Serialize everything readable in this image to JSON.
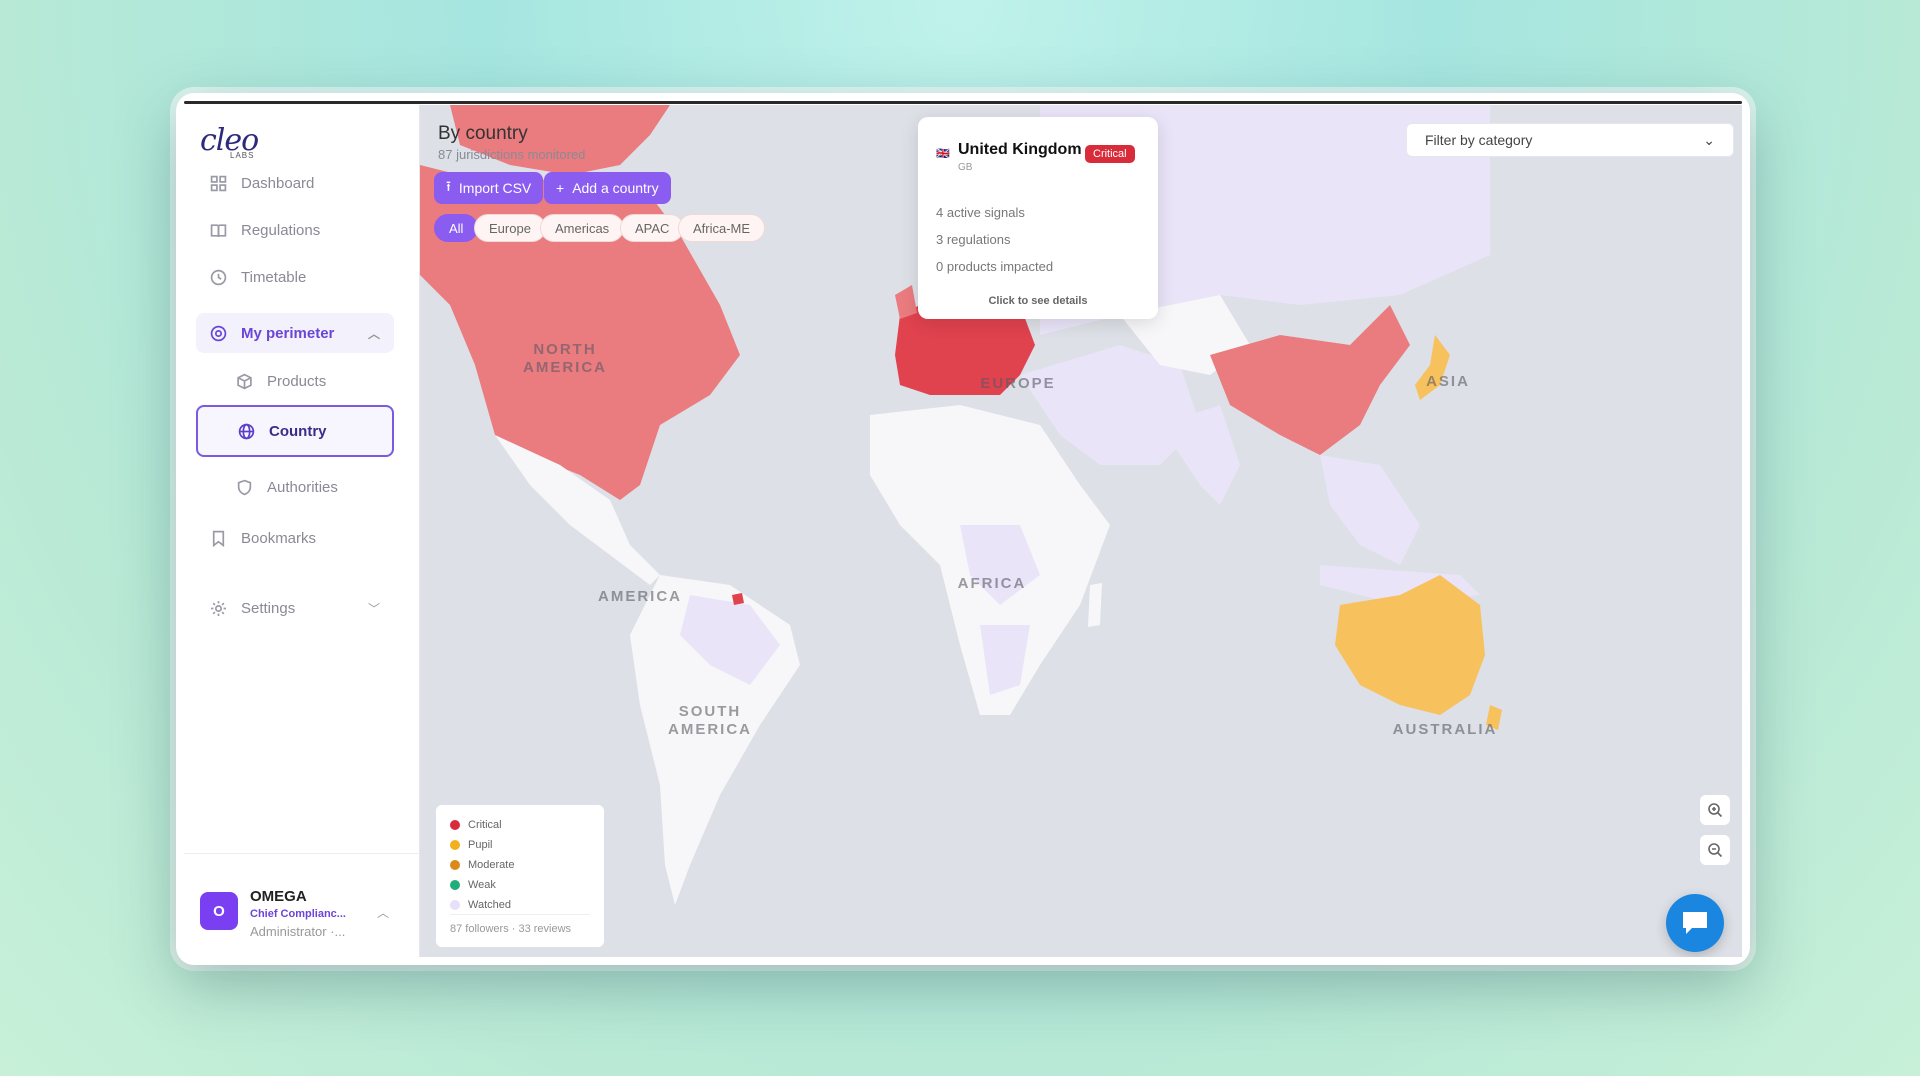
{
  "brand": {
    "logo": "cleo",
    "logo_sub": "LABS"
  },
  "nav": {
    "dashboard": "Dashboard",
    "regulations": "Regulations",
    "timetable": "Timetable",
    "my_perimeter": "My perimeter",
    "products": "Products",
    "country": "Country",
    "authorities": "Authorities",
    "bookmarks": "Bookmarks",
    "settings": "Settings"
  },
  "user": {
    "initial": "O",
    "name": "OMEGA",
    "role": "Chief Complianc...",
    "permission": "Administrator ·..."
  },
  "map": {
    "title": "By country",
    "subtitle": "87 jurisdictions monitored",
    "import_csv": "Import CSV",
    "add_country": "Add a country",
    "filters": [
      "All",
      "Europe",
      "Americas",
      "APAC",
      "Africa-ME"
    ],
    "active_filter": "All",
    "filter_dropdown": "Filter by category",
    "regions": {
      "north_america": "NORTH AMERICA",
      "europe": "EUROPE",
      "asia": "ASIA",
      "africa": "AFRICA",
      "america": "AMERICA",
      "south_america": "SOUTH AMERICA",
      "australia": "AUSTRALIA"
    }
  },
  "popup": {
    "country": "United Kingdom",
    "code": "GB",
    "badge": "Critical",
    "signals": "4 active signals",
    "regulations": "3 regulations",
    "products": "0 products impacted",
    "details": "Click to see details"
  },
  "legend": {
    "items": [
      {
        "label": "Critical",
        "color": "#d92c3a"
      },
      {
        "label": "Pupil",
        "color": "#f2b01e"
      },
      {
        "label": "Moderate",
        "color": "#d98a1a"
      },
      {
        "label": "Weak",
        "color": "#1fae7a"
      },
      {
        "label": "Watched",
        "color": "#e6e0f8"
      }
    ],
    "footer": "87 followers · 33 reviews"
  },
  "colors": {
    "accent": "#8a5cf0",
    "critical_fill": "#ea7b7f",
    "critical_dark": "#e0424e",
    "pupil_fill": "#f7c15e",
    "watched_fill": "#e9e4f8",
    "neutral_land": "#f7f7f9",
    "ocean": "#dde0e6"
  }
}
